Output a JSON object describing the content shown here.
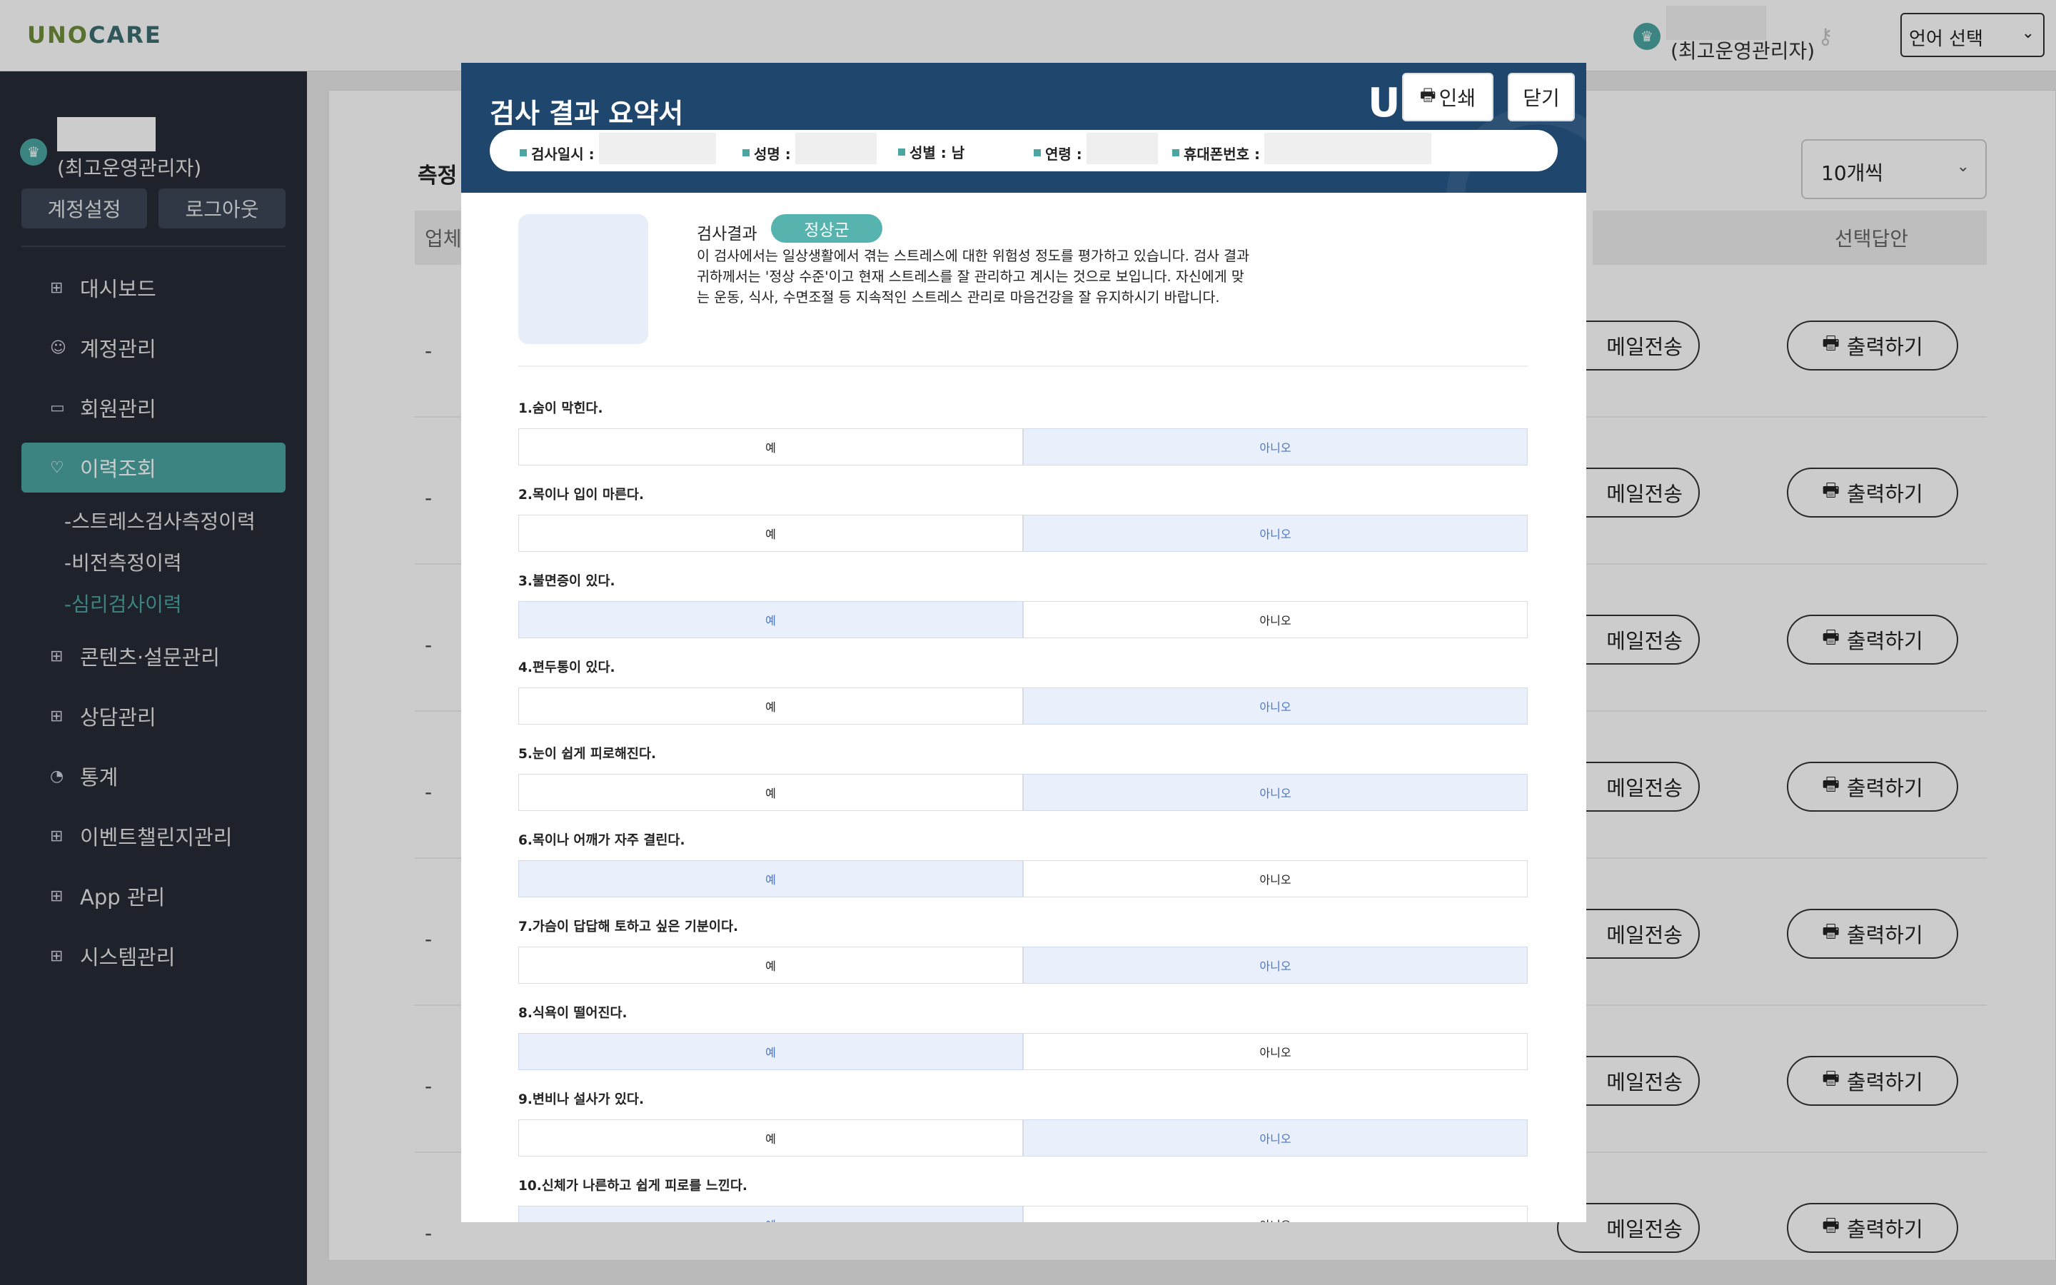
{
  "topbar": {
    "logo_uno": "UNO",
    "logo_care": "CARE",
    "user_role": "(최고운영관리자)",
    "language_select": "언어 선택"
  },
  "sidebar": {
    "user_role": "(최고운영관리자)",
    "account_settings": "계정설정",
    "logout": "로그아웃",
    "items": [
      {
        "label": "대시보드",
        "icon": "grid-icon"
      },
      {
        "label": "계정관리",
        "icon": "smile-icon"
      },
      {
        "label": "회원관리",
        "icon": "folder-icon"
      },
      {
        "label": "이력조회",
        "icon": "heart-icon",
        "active": true
      },
      {
        "label": "콘텐츠·설문관리",
        "icon": "grid-icon"
      },
      {
        "label": "상담관리",
        "icon": "grid-icon"
      },
      {
        "label": "통계",
        "icon": "chart-icon"
      },
      {
        "label": "이벤트챌린지관리",
        "icon": "grid-icon"
      },
      {
        "label": "App 관리",
        "icon": "grid-icon"
      },
      {
        "label": "시스템관리",
        "icon": "grid-icon"
      }
    ],
    "subitems": [
      "-스트레스검사측정이력",
      "-비전측정이력",
      "-심리검사이력"
    ]
  },
  "main": {
    "title": "측정",
    "page_size": "10개씩",
    "col_first": "업체",
    "col_last": "선택답안",
    "row_dash": "-",
    "mail_label": "메일전송",
    "print_label": "출력하기",
    "rows": 7
  },
  "modal": {
    "title": "검사 결과 요약서",
    "logo": "UNO",
    "print_button": "인쇄",
    "close_button": "닫기",
    "info": {
      "date_label": "검사일시 :",
      "name_label": "성명 :",
      "gender_label": "성별 : 남",
      "age_label": "연령 : ",
      "phone_label": "휴대폰번호 :"
    },
    "result_label": "검사결과",
    "result_badge": "정상군",
    "result_desc": "이 검사에서는 일상생활에서 겪는 스트레스에 대한 위험성 정도를 평가하고 있습니다. 검사 결과 귀하께서는 '정상 수준'이고 현재 스트레스를 잘 관리하고 계시는 것으로 보입니다. 자신에게 맞는 운동, 식사, 수면조절 등 지속적인 스트레스 관리로 마음건강을 잘 유지하시기 바랍니다.",
    "yes": "예",
    "no": "아니오",
    "questions": [
      {
        "text": "1.숨이 막힌다.",
        "selected": "no"
      },
      {
        "text": "2.목이나 입이 마른다.",
        "selected": "no"
      },
      {
        "text": "3.불면증이 있다.",
        "selected": "yes"
      },
      {
        "text": "4.편두통이 있다.",
        "selected": "no"
      },
      {
        "text": "5.눈이 쉽게 피로해진다.",
        "selected": "no"
      },
      {
        "text": "6.목이나 어깨가 자주 결린다.",
        "selected": "yes"
      },
      {
        "text": "7.가슴이 답답해 토하고 싶은 기분이다.",
        "selected": "no"
      },
      {
        "text": "8.식욕이 떨어진다.",
        "selected": "yes"
      },
      {
        "text": "9.변비나 설사가 있다.",
        "selected": "no"
      },
      {
        "text": "10.신체가 나른하고 쉽게 피로를 느낀다.",
        "selected": "yes"
      }
    ]
  },
  "colors": {
    "accent": "#4ba6a2",
    "modal_header": "#1f476d",
    "sidebar_bg": "#262b35",
    "selected_option": "#e9f0fb"
  }
}
